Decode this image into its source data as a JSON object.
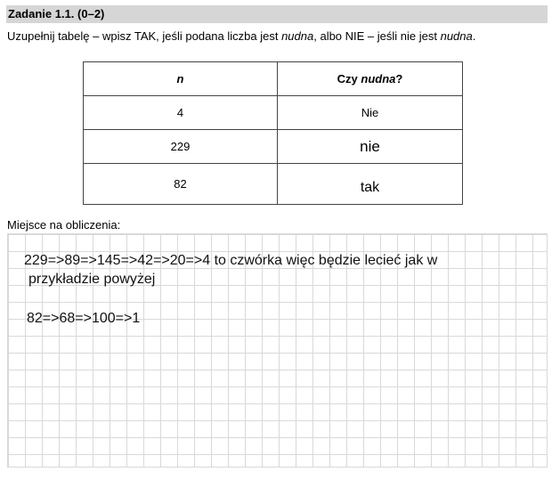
{
  "header": {
    "title": "Zadanie 1.1. (0–2)"
  },
  "instruction": {
    "part1": "Uzupełnij tabelę – wpisz TAK, jeśli podana liczba jest ",
    "italic1": "nudna",
    "part2": ", albo NIE – jeśli nie jest ",
    "italic2": "nudna",
    "part3": "."
  },
  "table": {
    "header_n": "n",
    "header_q_prefix": "Czy ",
    "header_q_italic": "nudna",
    "header_q_suffix": "?",
    "rows": [
      {
        "n": "4",
        "answer": "Nie"
      },
      {
        "n": "229",
        "answer": "nie"
      },
      {
        "n": "82",
        "answer": "tak"
      }
    ]
  },
  "work_area": {
    "label": "Miejsce na obliczenia:",
    "lines": [
      "229=>89=>145=>42=>20=>4 to czwórka więc będzie lecieć jak w",
      "przykładzie powyżej",
      "82=>68=>100=>1"
    ]
  }
}
